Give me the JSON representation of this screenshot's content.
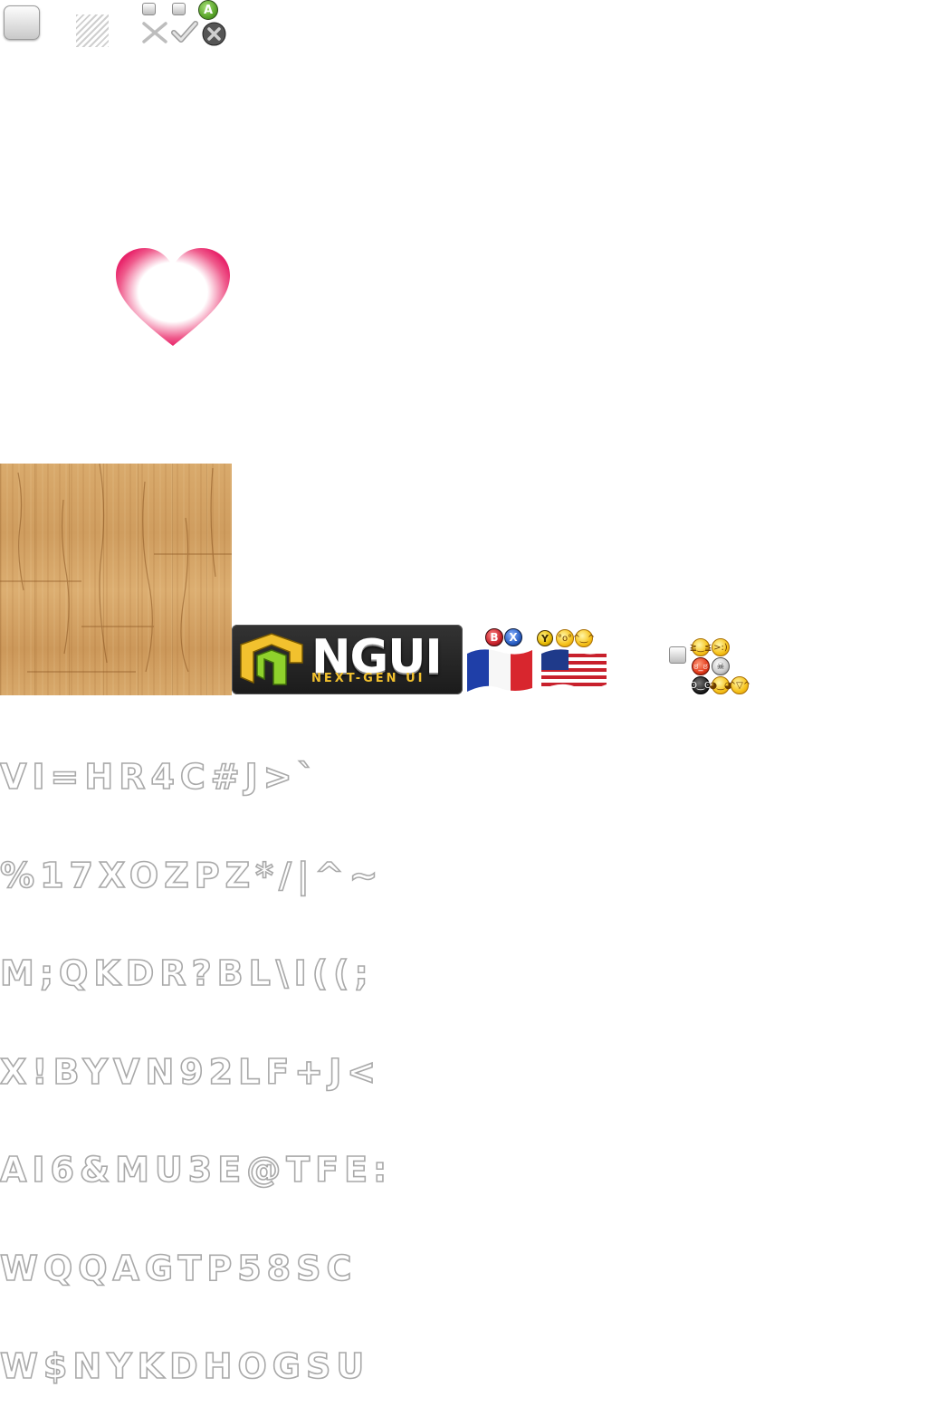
{
  "atlas": {
    "controller_buttons": {
      "a": "A",
      "b": "B",
      "x": "X",
      "y": "Y"
    },
    "logo": {
      "title": "NGUI",
      "subtitle": "NEXT-GEN UI"
    },
    "flags": [
      "france-flag",
      "usa-flag"
    ],
    "colors": {
      "heart": "#e8246a",
      "button_a": "#5aa52a",
      "button_b": "#c8232c",
      "button_x": "#2a5fc4",
      "button_y": "#e6b800",
      "wood": "#d4a266",
      "logo_accent": "#f2c12e"
    },
    "font_sheet_rows": [
      "VI=HR4C#J>`",
      "%17XOZPZ*/|^~",
      "M;QKDR?BL\\I((;",
      "X!BYVN92LF+J<",
      "AI6&MU3E@TFE:",
      "WQQAGTP58SC",
      "W$NYKDHOGSU"
    ]
  }
}
